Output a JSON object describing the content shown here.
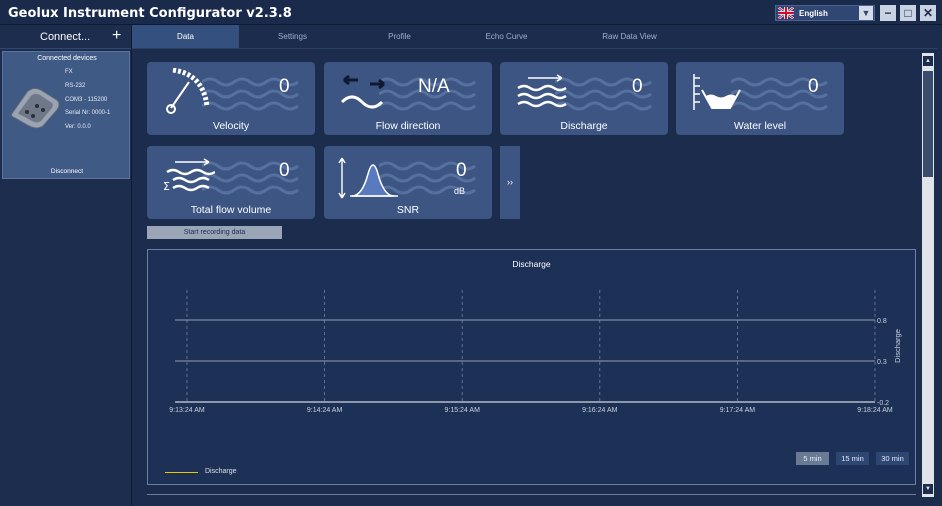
{
  "window": {
    "title": "Geolux Instrument Configurator v2.3.8",
    "language": "English",
    "controls": {
      "minimize": "−",
      "maximize": "□",
      "close": "✕"
    }
  },
  "sidebar": {
    "connect_label": "Connect...",
    "add_icon": "+",
    "device_section_title": "Connected devices",
    "device": {
      "model": "FX",
      "interface": "RS-232",
      "port": "COM3 - 115200",
      "serial": "Serial Nr: 0000-1",
      "version": "Ver: 0.0.0"
    },
    "disconnect_label": "Disconnect"
  },
  "tabs": [
    {
      "label": "Data",
      "active": true
    },
    {
      "label": "Settings",
      "active": false
    },
    {
      "label": "Profile",
      "active": false
    },
    {
      "label": "Echo Curve",
      "active": false
    },
    {
      "label": "Raw Data View",
      "active": false
    }
  ],
  "tiles": {
    "velocity": {
      "label": "Velocity",
      "value": "0",
      "icon": "speedometer-icon"
    },
    "flow_direction": {
      "label": "Flow direction",
      "value": "N/A",
      "icon": "flow-direction-icon"
    },
    "discharge": {
      "label": "Discharge",
      "value": "0",
      "icon": "discharge-icon"
    },
    "water_level": {
      "label": "Water level",
      "value": "0",
      "icon": "water-level-icon"
    },
    "total_flow_volume": {
      "label": "Total flow volume",
      "value": "0",
      "icon": "total-flow-icon"
    },
    "snr": {
      "label": "SNR",
      "value": "0",
      "unit": "dB",
      "icon": "snr-icon"
    }
  },
  "expand_label": "››",
  "record_button": "Start recording data",
  "chart_data": {
    "type": "line",
    "title": "Discharge",
    "ylabel": "Discharge",
    "x_ticks": [
      "9:13:24 AM",
      "9:14:24 AM",
      "9:15:24 AM",
      "9:16:24 AM",
      "9:17:24 AM",
      "9:18:24 AM"
    ],
    "y_ticks": [
      0.8,
      0.3,
      -0.2
    ],
    "ylim": [
      -0.2,
      0.8
    ],
    "grid": true,
    "legend_position": "bottom-left",
    "series": [
      {
        "name": "Discharge",
        "color": "#e6c800",
        "values": []
      }
    ],
    "range_buttons": [
      {
        "label": "5 min",
        "active": true
      },
      {
        "label": "15 min",
        "active": false
      },
      {
        "label": "30 min",
        "active": false
      }
    ]
  },
  "colors": {
    "background": "#1b2c4d",
    "tile": "#3c5582",
    "active_tab": "#33507e",
    "series": "#e6c800"
  }
}
